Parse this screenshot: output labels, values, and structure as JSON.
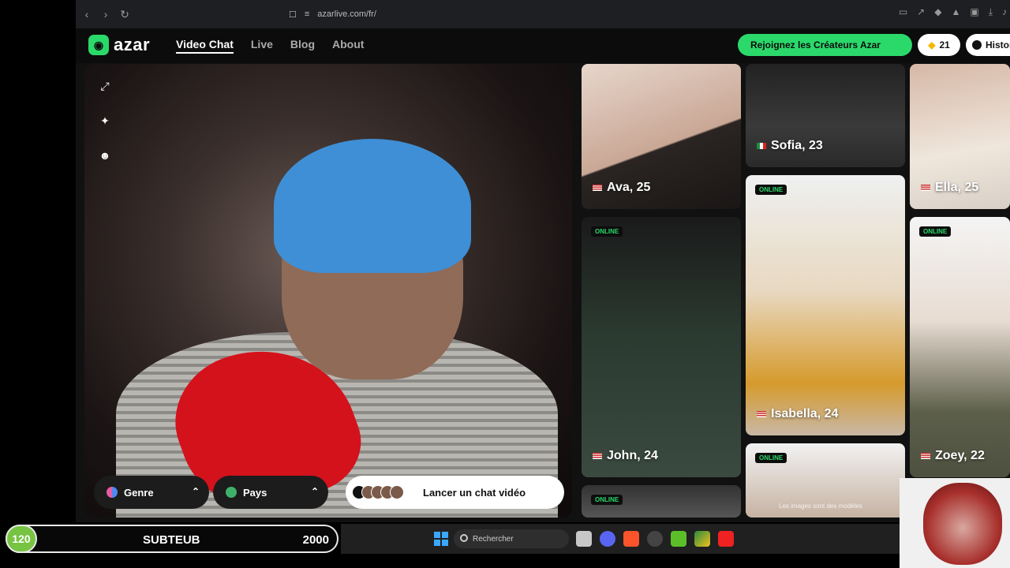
{
  "browser": {
    "url": "azarlive.com/fr/"
  },
  "header": {
    "logo_text": "azar",
    "nav": [
      {
        "label": "Video Chat",
        "active": true
      },
      {
        "label": "Live",
        "active": false
      },
      {
        "label": "Blog",
        "active": false
      },
      {
        "label": "About",
        "active": false
      }
    ],
    "cta_label": "Rejoignez les Créateurs Azar",
    "gems_count": "21",
    "history_label": "Histor"
  },
  "video": {
    "filters": [
      {
        "label": "Genre",
        "icon": "gender-icon"
      },
      {
        "label": "Pays",
        "icon": "globe-icon"
      }
    ],
    "launch_label": "Lancer un chat vidéo"
  },
  "cards": [
    {
      "name": "Ava, 25",
      "flag": "us",
      "online": false
    },
    {
      "name": "Sofia, 23",
      "flag": "it",
      "online": false
    },
    {
      "name": "Ella, 25",
      "flag": "us",
      "online": false
    },
    {
      "name": "John, 24",
      "flag": "us",
      "online": true
    },
    {
      "name": "Isabella, 24",
      "flag": "us",
      "online": true
    },
    {
      "name": "Zoey, 22",
      "flag": "us",
      "online": true
    },
    {
      "name": "",
      "flag": "",
      "online": true
    },
    {
      "name": "",
      "flag": "",
      "online": true
    }
  ],
  "online_tag": "ONLINE",
  "card_note": "Les images sont des modèles",
  "overlay": {
    "counter": "120",
    "label": "SUBTEUB",
    "goal": "2000"
  },
  "taskbar": {
    "search_placeholder": "Rechercher"
  },
  "colors": {
    "brand_green": "#2bd96b",
    "overlay_counter": "#76c442"
  }
}
